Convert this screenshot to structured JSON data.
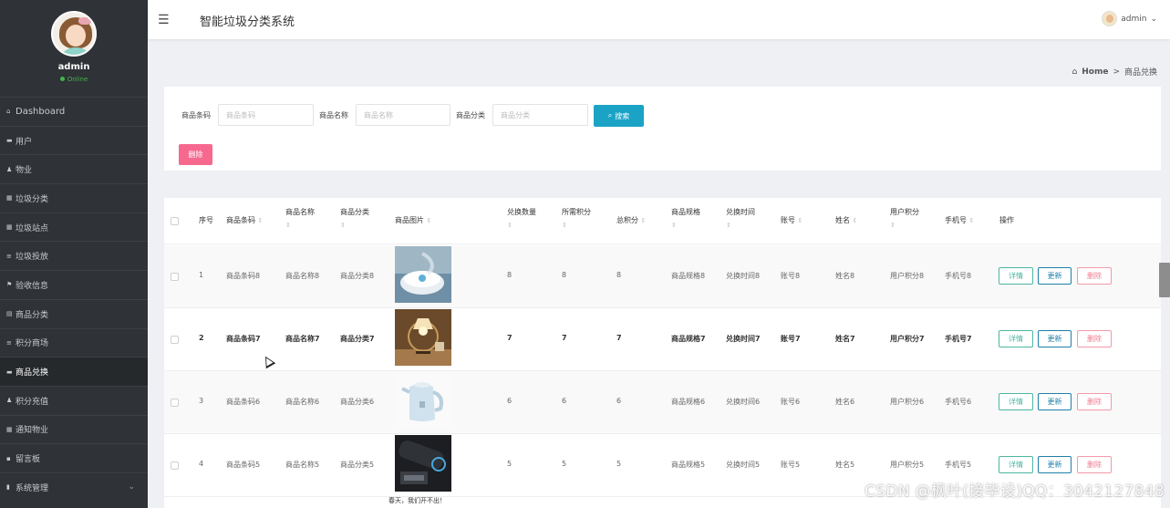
{
  "app": {
    "title": "智能垃圾分类系统"
  },
  "header": {
    "menu_icon": "menu-icon",
    "user_name": "admin",
    "user_caret": "⌄"
  },
  "sidebar": {
    "user_name": "admin",
    "status": "Online",
    "items": [
      {
        "label": "Dashboard",
        "icon": "home-icon"
      },
      {
        "label": "用户",
        "icon": "user-card-icon"
      },
      {
        "label": "物业",
        "icon": "person-icon"
      },
      {
        "label": "垃圾分类",
        "icon": "grid-icon"
      },
      {
        "label": "垃圾站点",
        "icon": "grid-icon"
      },
      {
        "label": "垃圾投放",
        "icon": "list-icon"
      },
      {
        "label": "验收信息",
        "icon": "flag-icon"
      },
      {
        "label": "商品分类",
        "icon": "box-icon"
      },
      {
        "label": "积分商场",
        "icon": "list-icon"
      },
      {
        "label": "商品兑换",
        "icon": "card-icon"
      },
      {
        "label": "积分充值",
        "icon": "person-icon"
      },
      {
        "label": "通知物业",
        "icon": "grid-icon"
      },
      {
        "label": "留言板",
        "icon": "message-icon"
      },
      {
        "label": "系统管理",
        "icon": "chart-icon"
      }
    ],
    "active_index": 9
  },
  "breadcrumb": {
    "home": "Home",
    "separator": ">",
    "current": "商品兑换"
  },
  "search": {
    "fields": [
      {
        "label": "商品条码",
        "placeholder": "商品条码"
      },
      {
        "label": "商品名称",
        "placeholder": "商品名称"
      },
      {
        "label": "商品分类",
        "placeholder": "商品分类"
      }
    ],
    "search_button": "搜索",
    "delete_button": "删除"
  },
  "table": {
    "headers": [
      "序号",
      "商品条码",
      "商品名称",
      "商品分类",
      "商品图片",
      "兑换数量",
      "所需积分",
      "总积分",
      "商品规格",
      "兑换时间",
      "账号",
      "姓名",
      "用户积分",
      "手机号",
      "操作"
    ],
    "rows": [
      {
        "index": "1",
        "barcode": "商品条码8",
        "name": "商品名称8",
        "category": "商品分类8",
        "image": "robot-vacuum",
        "qty": "8",
        "points": "8",
        "total": "8",
        "spec": "商品规格8",
        "time": "兑换时间8",
        "account": "账号8",
        "realname": "姓名8",
        "user_points": "用户积分8",
        "phone": "手机号8"
      },
      {
        "index": "2",
        "barcode": "商品条码7",
        "name": "商品名称7",
        "category": "商品分类7",
        "image": "table-lamp",
        "qty": "7",
        "points": "7",
        "total": "7",
        "spec": "商品规格7",
        "time": "兑换时间7",
        "account": "账号7",
        "realname": "姓名7",
        "user_points": "用户积分7",
        "phone": "手机号7"
      },
      {
        "index": "3",
        "barcode": "商品条码6",
        "name": "商品名称6",
        "category": "商品分类6",
        "image": "electric-kettle",
        "qty": "6",
        "points": "6",
        "total": "6",
        "spec": "商品规格6",
        "time": "兑换时间6",
        "account": "账号6",
        "realname": "姓名6",
        "user_points": "用户积分6",
        "phone": "手机号6"
      },
      {
        "index": "4",
        "barcode": "商品条码5",
        "name": "商品名称5",
        "category": "商品分类5",
        "image": "bluetooth-speaker",
        "qty": "5",
        "points": "5",
        "total": "5",
        "spec": "商品规格5",
        "time": "兑换时间5",
        "account": "账号5",
        "realname": "姓名5",
        "user_points": "用户积分5",
        "phone": "手机号5"
      }
    ],
    "actions": {
      "detail": "详情",
      "update": "更新",
      "delete": "删除"
    },
    "bold_row_index": 1
  },
  "footer_note": "春天，我们开不出！",
  "watermark": "CSDN @枫叶(接毕设)QQ：3042127848",
  "colors": {
    "sidebar_bg": "#2f3236",
    "accent": "#1ba3c6",
    "danger": "#f7688f",
    "detail": "#4db6a0",
    "update": "#1f7fa8",
    "online": "#43b549"
  }
}
